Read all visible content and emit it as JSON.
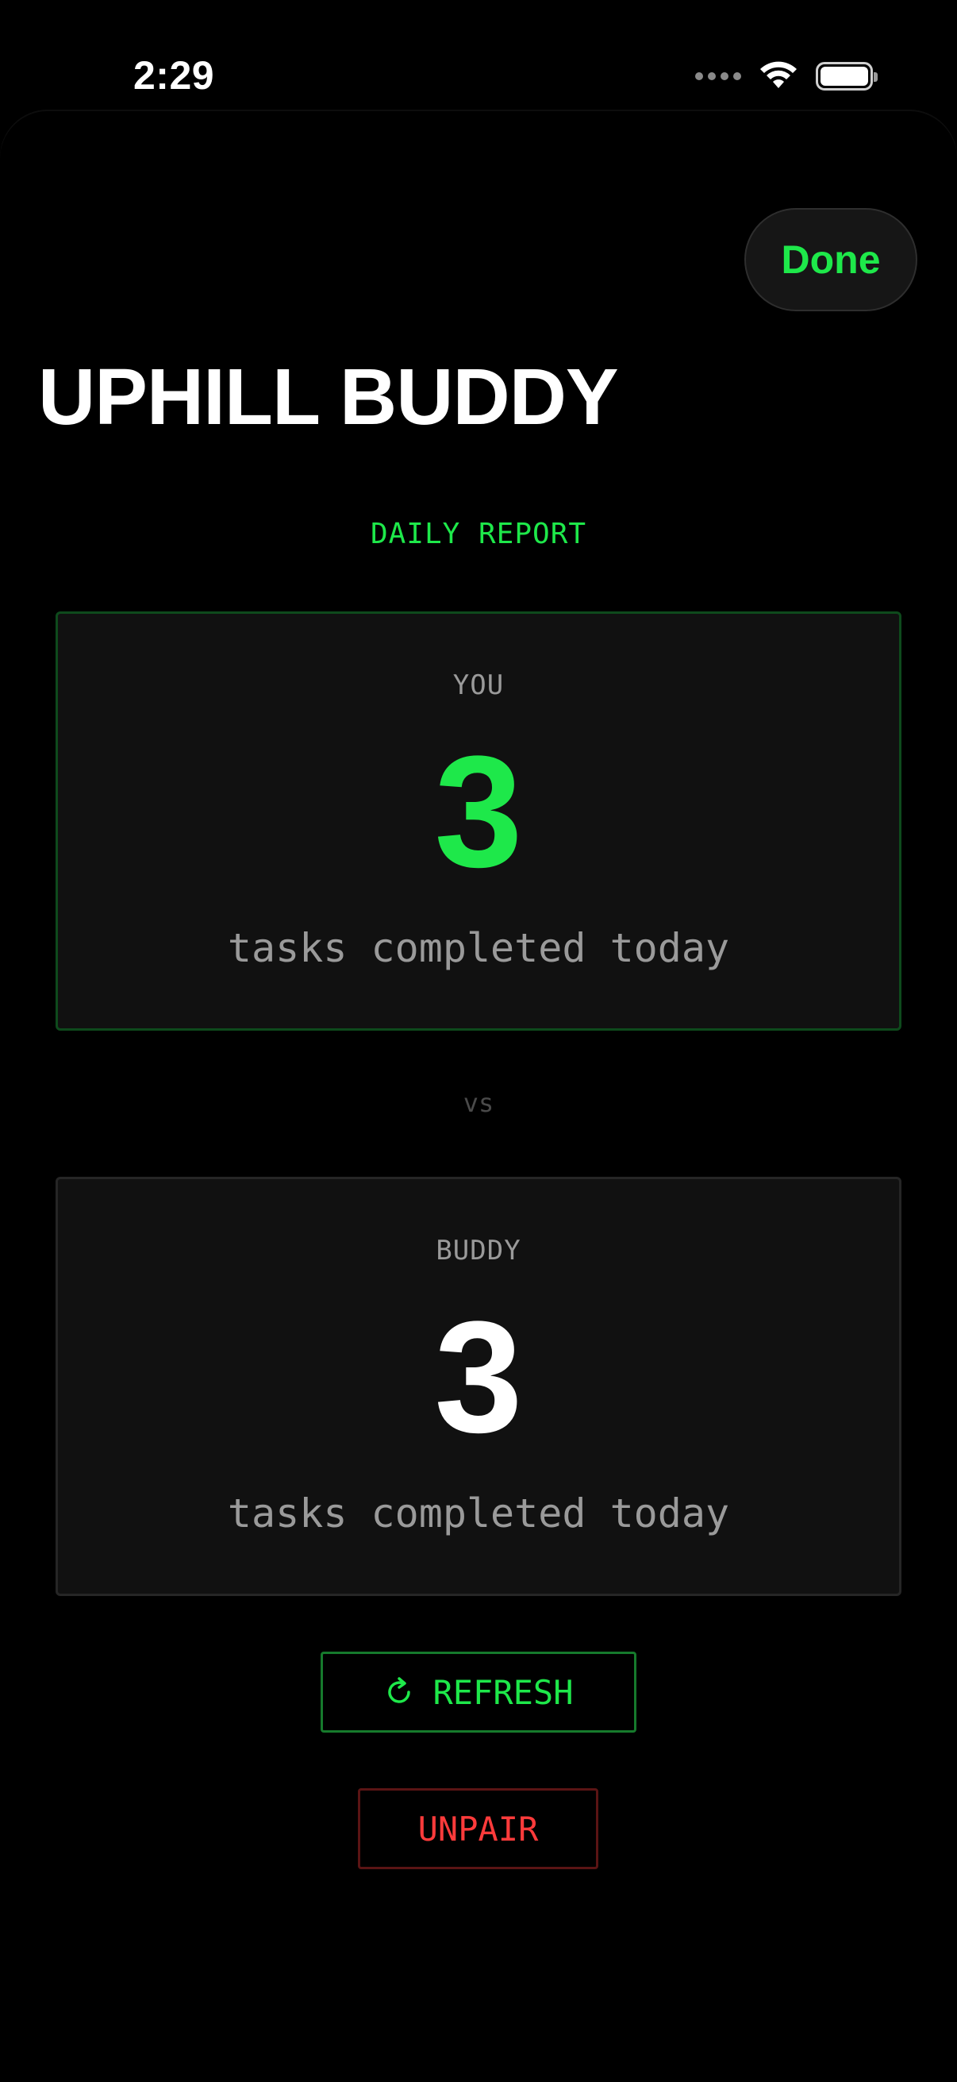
{
  "status_bar": {
    "time": "2:29",
    "icons": [
      "cellular-signal-icon",
      "wifi-icon",
      "battery-icon"
    ]
  },
  "header": {
    "done_label": "Done",
    "title": "UPHILL BUDDY"
  },
  "report": {
    "section_label": "DAILY REPORT",
    "you": {
      "label": "YOU",
      "count": "3",
      "caption": "tasks completed today"
    },
    "vs_label": "vs",
    "buddy": {
      "label": "BUDDY",
      "count": "3",
      "caption": "tasks completed today"
    }
  },
  "actions": {
    "refresh_label": "REFRESH",
    "unpair_label": "UNPAIR"
  },
  "colors": {
    "background": "#000000",
    "accent_green": "#1ee84a",
    "danger_red": "#ff3b3b",
    "card_background": "#111111",
    "muted_text": "#9a9a9a"
  }
}
